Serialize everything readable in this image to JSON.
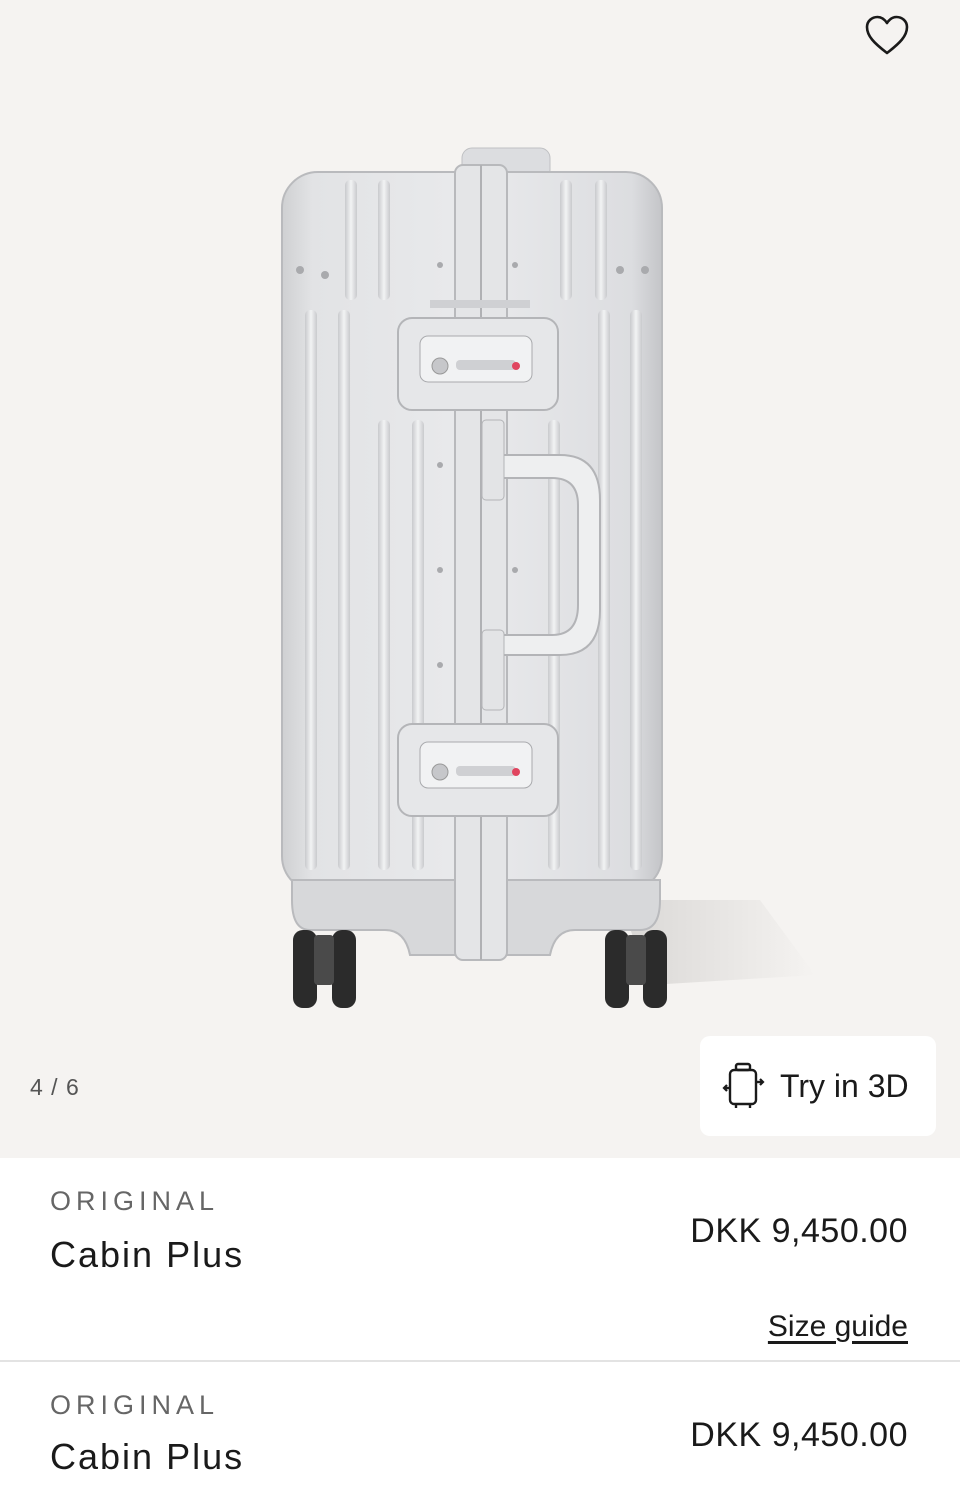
{
  "gallery": {
    "counter": "4 / 6",
    "try3d_label": "Try in 3D",
    "favorite_icon": "heart-outline-icon",
    "try3d_icon": "luggage-3d-icon"
  },
  "products": [
    {
      "collection": "ORIGINAL",
      "name": "Cabin Plus",
      "price": "DKK 9,450.00",
      "size_guide": "Size guide"
    },
    {
      "collection": "ORIGINAL",
      "name": "Cabin Plus",
      "price": "DKK 9,450.00"
    }
  ],
  "colors": {
    "gallery_bg": "#f5f3f1",
    "text": "#1a1a1a",
    "muted": "#666666",
    "lock_accent": "#e0455f"
  }
}
